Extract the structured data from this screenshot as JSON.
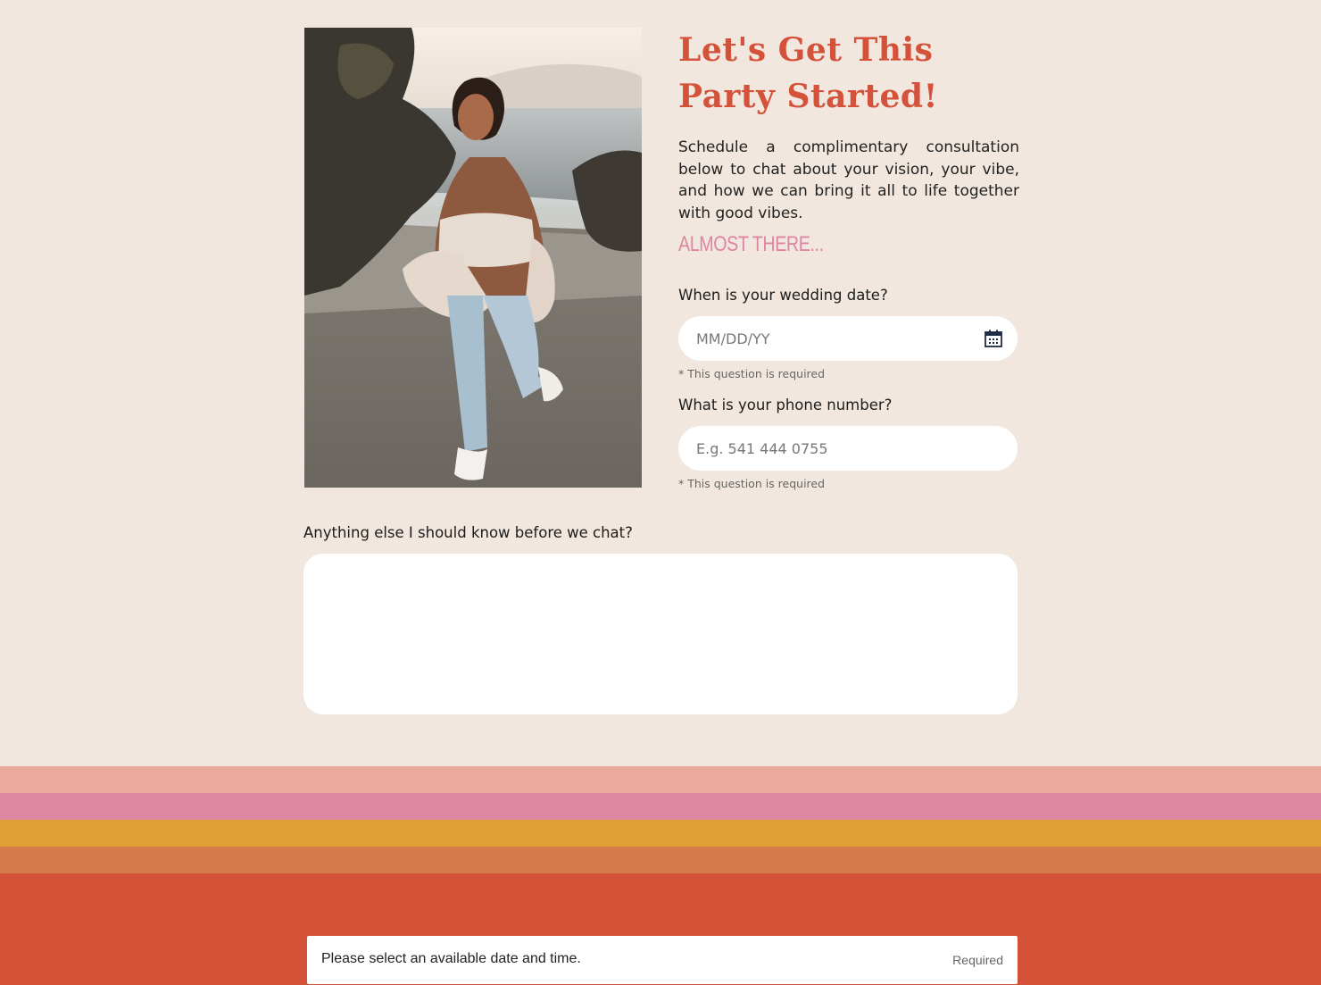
{
  "hero": {
    "photo_icon": "beach-portrait-photo",
    "title": "Let's Get This Party Started!",
    "intro": "Schedule a complimentary consultation below to chat about your vision, your vibe, and how we can bring it all to life together with good vibes.",
    "eyebrow": "Almost there..."
  },
  "form": {
    "date_label": "When is your wedding date?",
    "date_placeholder": "MM/DD/YY",
    "date_icon": "calendar-icon",
    "date_hint": "* This question is required",
    "phone_label": "What is your phone number?",
    "phone_placeholder": "E.g. 541 444 0755",
    "phone_hint": "* This question is required",
    "notes_label": "Anything else I should know before we chat?",
    "notes_value": ""
  },
  "footer": {
    "stripe_colors": [
      "#eaa99c",
      "#df86a1",
      "#e1a036",
      "#d57b4a",
      "#d45338"
    ],
    "booking_text": "Please select an available date and time.",
    "booking_required": "Required"
  },
  "colors": {
    "background": "#f1e7de",
    "title": "#d4523a",
    "eyebrow": "#de85a2"
  }
}
